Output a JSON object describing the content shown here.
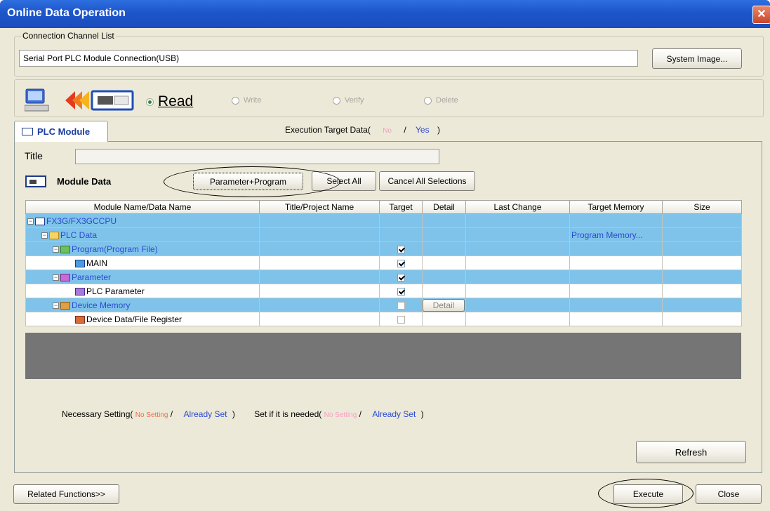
{
  "window": {
    "title": "Online Data Operation",
    "close_glyph": "✕"
  },
  "connection": {
    "group_label": "Connection Channel List",
    "value": "Serial Port  PLC Module Connection(USB)",
    "system_image_button": "System Image..."
  },
  "mode": {
    "options": [
      {
        "label": "Read",
        "selected": true,
        "enabled": true
      },
      {
        "label": "Write",
        "selected": false,
        "enabled": false
      },
      {
        "label": "Verify",
        "selected": false,
        "enabled": false
      },
      {
        "label": "Delete",
        "selected": false,
        "enabled": false
      }
    ]
  },
  "tab": {
    "label": "PLC Module"
  },
  "execution_target": {
    "prefix": "Execution Target Data(",
    "no": "No",
    "sep": "/",
    "yes": "Yes",
    "suffix": ")"
  },
  "title_field": {
    "label": "Title",
    "value": ""
  },
  "module_data": {
    "label": "Module Data",
    "buttons": [
      "Parameter+Program",
      "Select All",
      "Cancel All Selections"
    ]
  },
  "table": {
    "columns": [
      "Module Name/Data Name",
      "Title/Project Name",
      "Target",
      "Detail",
      "Last Change",
      "Target Memory",
      "Size"
    ],
    "rows": [
      {
        "name": "FX3G/FX3GCCPU",
        "level": 0,
        "expander": "−",
        "icon": "cpu-icon",
        "style": "blue",
        "target": null,
        "detail": "",
        "memory": ""
      },
      {
        "name": "PLC Data",
        "level": 1,
        "expander": "−",
        "icon": "folder-icon",
        "style": "blue",
        "target": null,
        "detail": "",
        "memory": "Program Memory..."
      },
      {
        "name": "Program(Program File)",
        "level": 2,
        "expander": "−",
        "icon": "program-folder-icon",
        "style": "blue",
        "target": true,
        "detail": "",
        "memory": ""
      },
      {
        "name": "MAIN",
        "level": 3,
        "expander": "",
        "icon": "program-icon",
        "style": "white",
        "target": true,
        "detail": "",
        "memory": ""
      },
      {
        "name": "Parameter",
        "level": 2,
        "expander": "−",
        "icon": "parameter-folder-icon",
        "style": "blue",
        "target": true,
        "detail": "",
        "memory": ""
      },
      {
        "name": "PLC Parameter",
        "level": 3,
        "expander": "",
        "icon": "parameter-icon",
        "style": "white",
        "target": true,
        "detail": "",
        "memory": ""
      },
      {
        "name": "Device Memory",
        "level": 2,
        "expander": "−",
        "icon": "device-memory-icon",
        "style": "blue",
        "target": false,
        "detail": "Detail",
        "memory": ""
      },
      {
        "name": "Device Data/File Register",
        "level": 3,
        "expander": "",
        "icon": "device-data-icon",
        "style": "white",
        "target": false,
        "detail": "",
        "memory": ""
      }
    ]
  },
  "legend": {
    "necessary_prefix": "Necessary Setting(",
    "no_setting": "No Setting",
    "sep": "/",
    "already_set": "Already Set",
    "close_paren": ")",
    "if_needed_prefix": "Set if it is needed("
  },
  "buttons": {
    "refresh": "Refresh",
    "related": "Related Functions>>",
    "execute": "Execute",
    "close": "Close"
  },
  "colors": {
    "titlebar": "#1d55c9",
    "row_highlight": "#7fc3ea",
    "no_setting_red": "#f26a4a",
    "no_pink": "#f5a0c0",
    "set_blue": "#2c4bd1"
  }
}
